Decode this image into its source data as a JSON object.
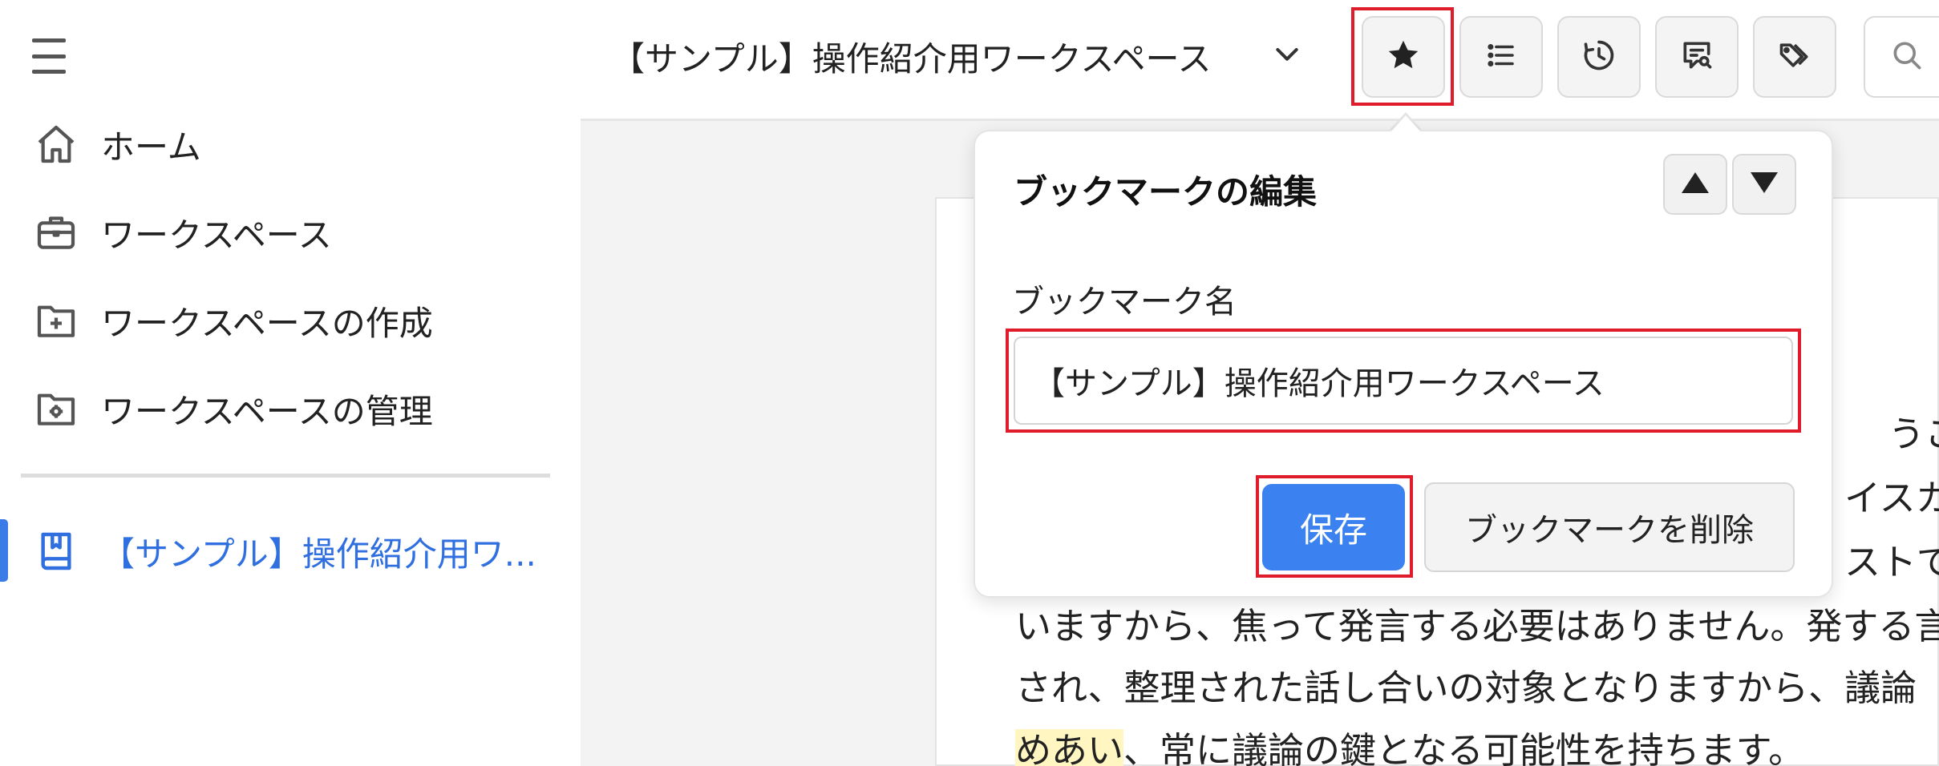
{
  "sidebar": {
    "menu_icon": "hamburger-menu-icon",
    "items": [
      {
        "label": "ホーム",
        "icon": "home-icon"
      },
      {
        "label": "ワークスペース",
        "icon": "briefcase-icon"
      },
      {
        "label": "ワークスペースの作成",
        "icon": "folder-plus-icon"
      },
      {
        "label": "ワークスペースの管理",
        "icon": "folder-gear-icon"
      }
    ],
    "bookmark": {
      "label": "【サンプル】操作紹介用ワ...",
      "icon": "bookmark-book-icon"
    }
  },
  "header": {
    "workspace_title": "【サンプル】操作紹介用ワークスペース",
    "toolbar": [
      "star-icon",
      "list-icon",
      "history-icon",
      "comment-search-icon",
      "tags-icon",
      "search-icon"
    ]
  },
  "popover": {
    "title": "ブックマークの編集",
    "name_label": "ブックマーク名",
    "name_value": "【サンプル】操作紹介用ワークスペース",
    "save_label": "保存",
    "delete_label": "ブックマークを削除"
  },
  "document": {
    "frag1": "うこと",
    "frag2": "イスカッ",
    "frag3": "ストで",
    "line4": "いますから、焦って発言する必要はありません。発する言",
    "line5": "され、整理された話し合いの対象となりますから、議論",
    "line6_highlight": "めあい",
    "line6_rest": "、常に議論の鍵となる可能性を持ちます。"
  },
  "colors": {
    "accent": "#3b82f0",
    "link": "#2f6fe0",
    "highlight_box": "#e01c2a"
  }
}
